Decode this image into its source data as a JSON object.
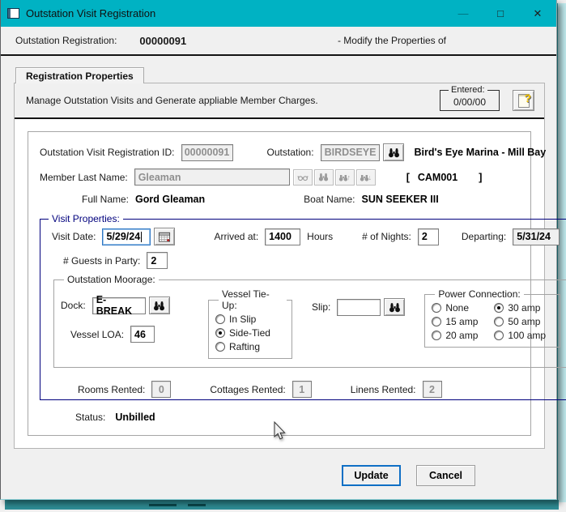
{
  "window": {
    "title": "Outstation Visit Registration",
    "controls": {
      "minimize": "—",
      "maximize": "□",
      "close": "✕"
    }
  },
  "header": {
    "label": "Outstation Registration:",
    "value": "00000091",
    "right_text": "- Modify the Properties of"
  },
  "tab": {
    "label": "Registration Properties"
  },
  "intro": {
    "text": "Manage Outstation Visits and Generate appliable Member Charges.",
    "entered_label": "Entered:",
    "entered_value": "0/00/00"
  },
  "registration": {
    "id_label": "Outstation Visit Registration ID:",
    "id_value": "00000091",
    "outstation_label": "Outstation:",
    "outstation_value": "BIRDSEYE",
    "outstation_name": "Bird's Eye Marina - Mill Bay",
    "member_last_name_label": "Member Last Name:",
    "member_last_name_value": "Gleaman",
    "member_code_open": "[",
    "member_code": "CAM001",
    "member_code_close": "]",
    "full_name_label": "Full Name:",
    "full_name_value": "Gord Gleaman",
    "boat_name_label": "Boat Name:",
    "boat_name_value": "SUN SEEKER III"
  },
  "visit": {
    "group_label": "Visit Properties:",
    "visit_date_label": "Visit Date:",
    "visit_date_value": "5/29/24",
    "arrived_label": "Arrived at:",
    "arrived_value": "1400",
    "hours_label": "Hours",
    "nights_label": "# of Nights:",
    "nights_value": "2",
    "departing_label": "Departing:",
    "departing_value": "5/31/24",
    "guests_label": "# Guests in Party:",
    "guests_value": "2",
    "moorage": {
      "group_label": "Outstation Moorage:",
      "dock_label": "Dock:",
      "dock_value": "E-BREAK",
      "vessel_loa_label": "Vessel LOA:",
      "vessel_loa_value": "46",
      "tie_up": {
        "group_label": "Vessel Tie-Up:",
        "options": [
          {
            "label": "In Slip",
            "selected": false
          },
          {
            "label": "Side-Tied",
            "selected": true
          },
          {
            "label": "Rafting",
            "selected": false
          }
        ]
      },
      "slip_label": "Slip:",
      "slip_value": "",
      "power": {
        "group_label": "Power Connection:",
        "columns": [
          [
            {
              "label": "None",
              "selected": false
            },
            {
              "label": "15 amp",
              "selected": false
            },
            {
              "label": "20 amp",
              "selected": false
            }
          ],
          [
            {
              "label": "30 amp",
              "selected": true
            },
            {
              "label": "50 amp",
              "selected": false
            },
            {
              "label": "100 amp",
              "selected": false
            }
          ]
        ]
      }
    },
    "rooms_label": "Rooms Rented:",
    "rooms_value": "0",
    "cottages_label": "Cottages Rented:",
    "cottages_value": "1",
    "linens_label": "Linens Rented:",
    "linens_value": "2"
  },
  "status": {
    "label": "Status:",
    "value": "Unbilled"
  },
  "buttons": {
    "update": "Update",
    "cancel": "Cancel"
  },
  "colors": {
    "titlebar": "#00b2c3",
    "accent": "#0f6fc5",
    "group_border": "#00007d",
    "behind_window": "#2f8e96"
  }
}
